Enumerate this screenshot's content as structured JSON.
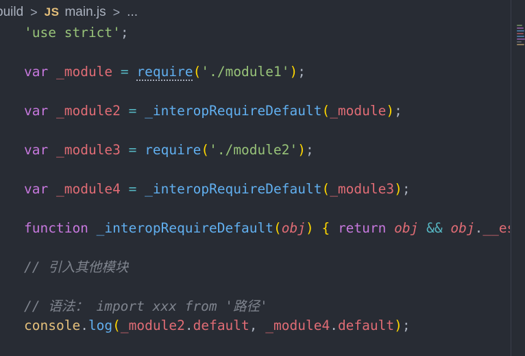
{
  "breadcrumb": {
    "folder": "build",
    "separator": ">",
    "file_icon": "JS",
    "file": "main.js",
    "ellipsis": "..."
  },
  "code": {
    "line1": {
      "str": "'use strict'",
      "semi": ";"
    },
    "line2": {
      "kw": "var",
      "name": "_module",
      "eq": "=",
      "fn": "require",
      "open": "(",
      "arg": "'./module1'",
      "close": ")",
      "semi": ";"
    },
    "line3": {
      "kw": "var",
      "name": "_module2",
      "eq": "=",
      "fn": "_interopRequireDefault",
      "open": "(",
      "arg": "_module",
      "close": ")",
      "semi": ";"
    },
    "line4": {
      "kw": "var",
      "name": "_module3",
      "eq": "=",
      "fn": "require",
      "open": "(",
      "arg": "'./module2'",
      "close": ")",
      "semi": ";"
    },
    "line5": {
      "kw": "var",
      "name": "_module4",
      "eq": "=",
      "fn": "_interopRequireDefault",
      "open": "(",
      "arg": "_module3",
      "close": ")",
      "semi": ";"
    },
    "line6": {
      "kw": "function",
      "fn": "_interopRequireDefault",
      "open": "(",
      "param": "obj",
      "close": ")",
      "brace": "{",
      "ret": "return",
      "obj1": "obj",
      "and": "&&",
      "obj2": "obj",
      "dot": ".",
      "prop": "__esM"
    },
    "line7": {
      "comment": "// 引入其他模块"
    },
    "line8": {
      "comment": "// 语法： import xxx from '路径'"
    },
    "line9": {
      "obj": "console",
      "dot": ".",
      "fn": "log",
      "open": "(",
      "a1": "_module2",
      "d1": ".",
      "p1": "default",
      "comma": ", ",
      "a2": "_module4",
      "d2": ".",
      "p2": "default",
      "close": ")",
      "semi": ";"
    }
  },
  "colors": {
    "background": "#282c34",
    "keyword": "#c678dd",
    "variable": "#e06c75",
    "function": "#61afef",
    "string": "#98c379",
    "comment": "#7f848e",
    "bracket": "#ffd700"
  }
}
